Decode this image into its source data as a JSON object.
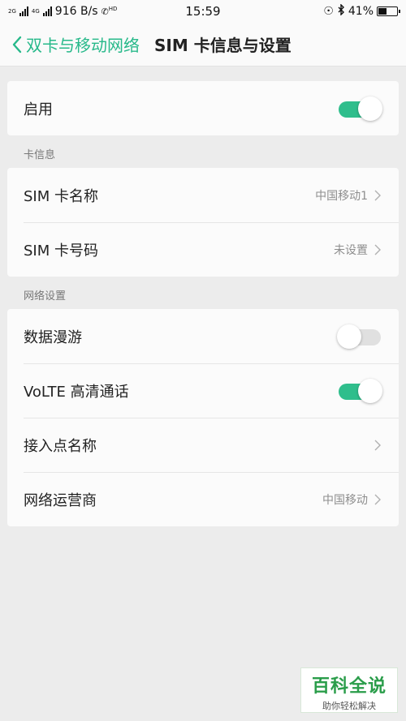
{
  "status_bar": {
    "net_tag": "2G",
    "net_tag2": "4G",
    "speed": "916 B/s",
    "hd": "HD",
    "time": "15:59",
    "battery_text": "41%",
    "battery_level": 0.41
  },
  "header": {
    "back_label": "双卡与移动网络",
    "title": "SIM 卡信息与设置"
  },
  "enable": {
    "label": "启用",
    "on": true
  },
  "card_info": {
    "section": "卡信息",
    "items": [
      {
        "label": "SIM 卡名称",
        "value": "中国移动1"
      },
      {
        "label": "SIM 卡号码",
        "value": "未设置"
      }
    ]
  },
  "network": {
    "section": "网络设置",
    "roaming": {
      "label": "数据漫游",
      "on": false
    },
    "volte": {
      "label": "VoLTE 高清通话",
      "on": true
    },
    "apn": {
      "label": "接入点名称",
      "value": ""
    },
    "operator": {
      "label": "网络运营商",
      "value": "中国移动"
    }
  },
  "watermark": {
    "title": "百科全说",
    "subtitle": "助你轻松解决"
  },
  "colors": {
    "accent": "#2fbe8c",
    "background": "#ececec"
  }
}
